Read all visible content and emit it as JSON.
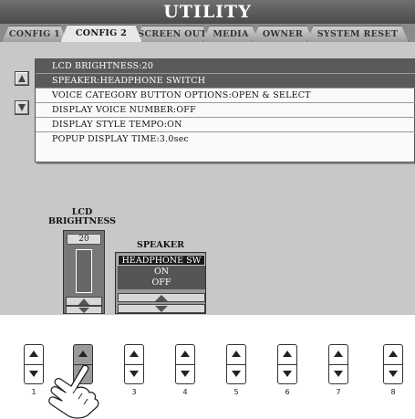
{
  "title": "UTILITY",
  "tabs": [
    "CONFIG 1",
    "CONFIG 2",
    "SCREEN OUT",
    "MEDIA",
    "OWNER",
    "SYSTEM RESET"
  ],
  "active_tab": "CONFIG 2",
  "list": {
    "group_labels": [
      "1",
      "2"
    ],
    "rows": [
      "LCD BRIGHTNESS:20",
      "SPEAKER:HEADPHONE SWITCH",
      "VOICE CATEGORY BUTTON OPTIONS:OPEN & SELECT",
      "DISPLAY VOICE NUMBER:OFF",
      "DISPLAY STYLE TEMPO:ON",
      "POPUP DISPLAY TIME:3.0sec"
    ],
    "selected_rows": [
      0,
      1
    ]
  },
  "lcd": {
    "label_line1": "LCD",
    "label_line2": "BRIGHTNESS",
    "value": "20",
    "level_fraction": 0.0
  },
  "speaker": {
    "label": "SPEAKER",
    "options": [
      "HEADPHONE SW",
      "ON",
      "OFF"
    ],
    "selected": "HEADPHONE SW"
  },
  "hardware_buttons": {
    "numbers": [
      "1",
      "2",
      "3",
      "4",
      "5",
      "6",
      "7",
      "8"
    ],
    "pressed": "2"
  },
  "colors": {
    "screen_bg": "#bdbdbd",
    "highlight": "#5a5a5a",
    "title_bar": "#4a4a4a"
  }
}
